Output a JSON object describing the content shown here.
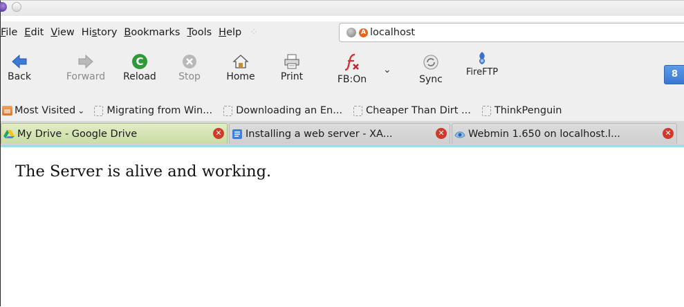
{
  "menu": {
    "items": [
      "File",
      "Edit",
      "View",
      "History",
      "Bookmarks",
      "Tools",
      "Help"
    ],
    "mnemonics": [
      "F",
      "E",
      "V",
      "s",
      "B",
      "T",
      "H"
    ]
  },
  "address_bar": {
    "value": "localhost"
  },
  "navigation": {
    "back": "Back",
    "forward": "Forward",
    "reload": "Reload",
    "stop": "Stop",
    "home": "Home",
    "print": "Print",
    "fb": "FB:On",
    "sync": "Sync",
    "fireftp": "FireFTP"
  },
  "search_engine_badge": "8",
  "bookmarks": {
    "most_visited": "Most Visited",
    "items": [
      "Migrating from Win...",
      "Downloading an En...",
      "Cheaper Than Dirt ...",
      "ThinkPenguin"
    ]
  },
  "tabs": [
    {
      "title": "My Drive - Google Drive",
      "active": true
    },
    {
      "title": "Installing a web server - XA...",
      "active": false
    },
    {
      "title": "Webmin 1.650 on localhost.l...",
      "active": false
    }
  ],
  "page": {
    "text": "The Server is alive and working."
  },
  "colors": {
    "toolbar_bg": "#efefef",
    "active_tab": "#c9dca5",
    "tab_underline": "#9ee0e6",
    "close_red": "#d13a2a"
  }
}
